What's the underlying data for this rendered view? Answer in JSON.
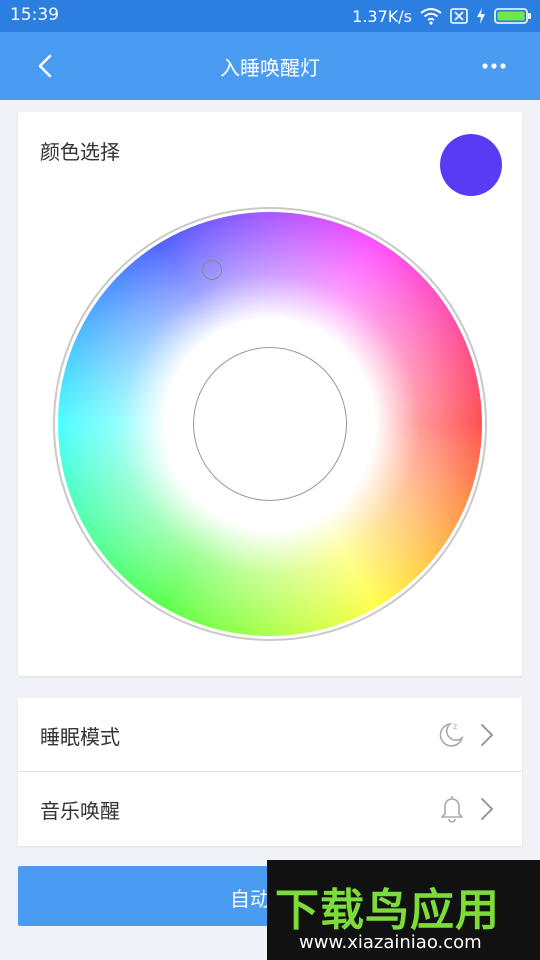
{
  "status_bar": {
    "time": "15:39",
    "network_speed": "1.37K/s",
    "icons": [
      "wifi-icon",
      "sim-blocked-icon",
      "charging-icon",
      "battery-icon"
    ]
  },
  "title_bar": {
    "title": "入睡唤醒灯",
    "back_icon": "chevron-left-icon",
    "more_icon": "more-dots-icon"
  },
  "color_section": {
    "label": "颜色选择",
    "selected_color": "#5a3bf5"
  },
  "settings_list": [
    {
      "label": "睡眠模式",
      "icon": "moon-zzz-icon"
    },
    {
      "label": "音乐唤醒",
      "icon": "bell-icon"
    }
  ],
  "bottom_button": {
    "label": "自动"
  },
  "watermark": {
    "brand": "下载鸟应用",
    "url": "www.xiazainiao.com"
  },
  "colors": {
    "status_bar": "#2b7fe0",
    "title_bar": "#4a9bf2",
    "accent": "#4a9bf2",
    "background": "#f0f2f7",
    "watermark_text": "#7bdc3a"
  }
}
